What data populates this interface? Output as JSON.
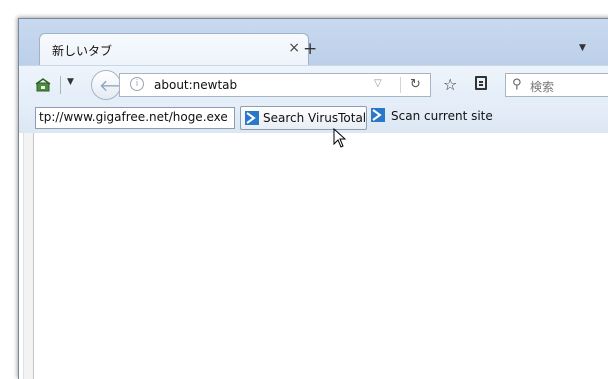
{
  "tabs": [
    {
      "title": "新しいタブ",
      "active": true
    }
  ],
  "tab_close_glyph": "×",
  "new_tab_glyph": "+",
  "nav": {
    "url": "about:newtab",
    "search_placeholder": "検索"
  },
  "virustotal_toolbar": {
    "url_input_value": "tp://www.gigafree.net/hoge.exe",
    "search_button_label": "Search VirusTotal",
    "scan_link_label": "Scan current site"
  },
  "icons": {
    "home": "home-icon",
    "back": "back-arrow-icon",
    "info": "info-icon",
    "reload": "reload-icon",
    "bookmark": "star-icon",
    "reader": "clipboard-icon",
    "search": "search-icon",
    "virustotal": "virustotal-logo-icon"
  },
  "colors": {
    "chrome_blue": "#c9d9ee",
    "virustotal_blue": "#2a78c8"
  }
}
